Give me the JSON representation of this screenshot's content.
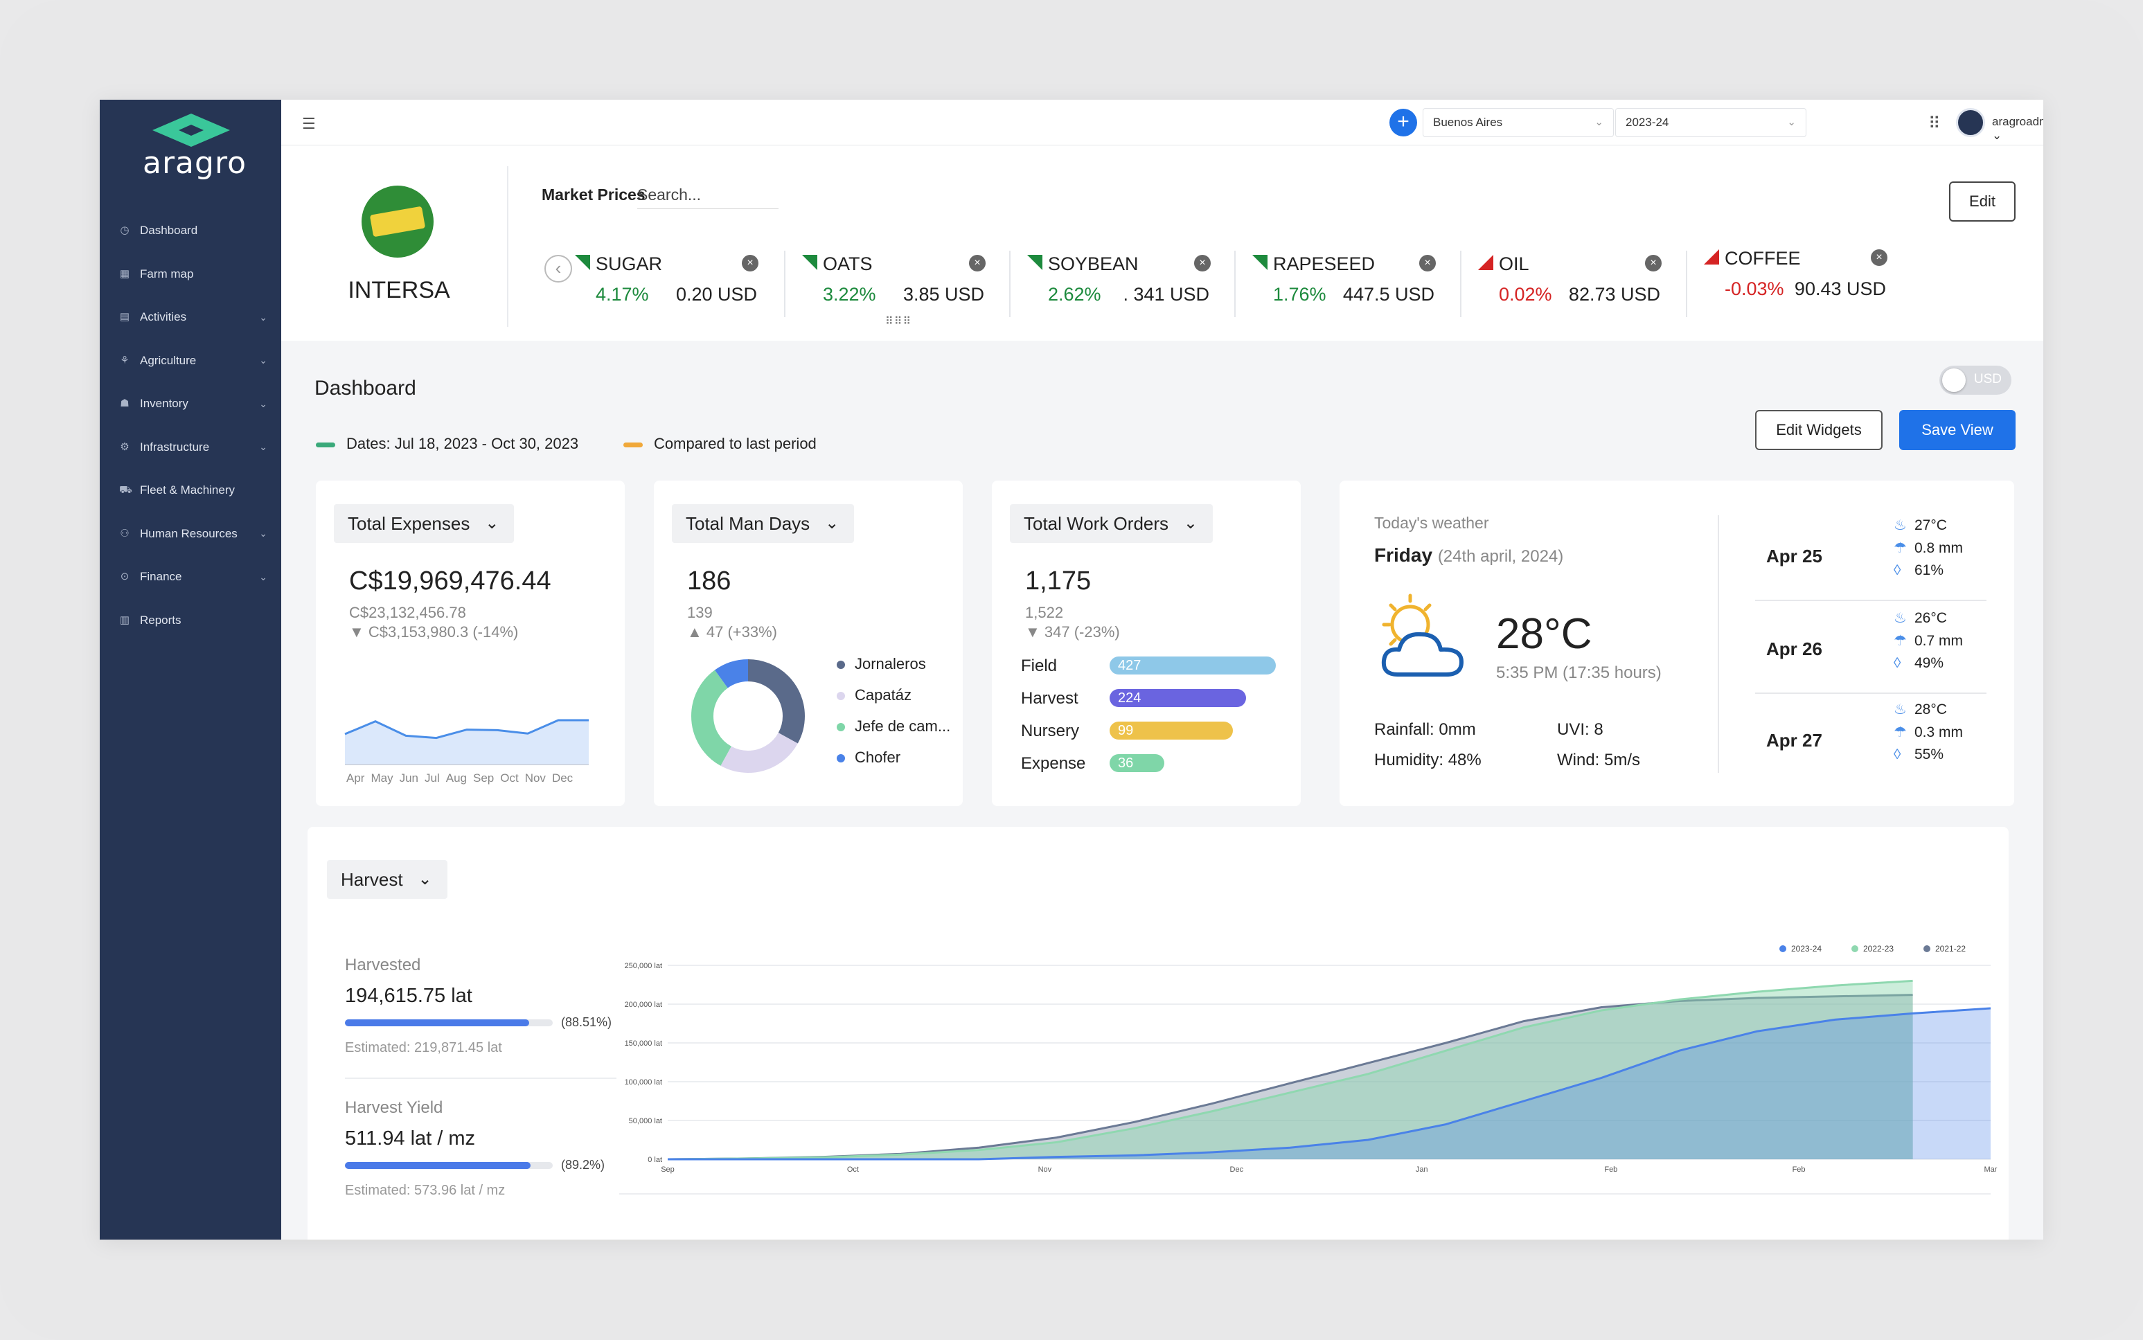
{
  "brand": {
    "name": "aragro"
  },
  "sidebar": {
    "items": [
      {
        "label": "Dashboard",
        "icon": "dashboard-icon",
        "has_children": false
      },
      {
        "label": "Farm map",
        "icon": "map-icon",
        "has_children": false
      },
      {
        "label": "Activities",
        "icon": "activities-icon",
        "has_children": true
      },
      {
        "label": "Agriculture",
        "icon": "plant-icon",
        "has_children": true
      },
      {
        "label": "Inventory",
        "icon": "inventory-icon",
        "has_children": true
      },
      {
        "label": "Infrastructure",
        "icon": "infrastructure-icon",
        "has_children": true
      },
      {
        "label": "Fleet & Machinery",
        "icon": "truck-icon",
        "has_children": false
      },
      {
        "label": "Human Resources",
        "icon": "people-icon",
        "has_children": true
      },
      {
        "label": "Finance",
        "icon": "finance-icon",
        "has_children": true
      },
      {
        "label": "Reports",
        "icon": "reports-icon",
        "has_children": false
      }
    ]
  },
  "topbar": {
    "location": "Buenos Aires",
    "season": "2023-24",
    "user": "aragroadmin"
  },
  "company": {
    "name": "INTERSA"
  },
  "market": {
    "title": "Market Prices",
    "search_placeholder": "Search...",
    "edit_label": "Edit",
    "tickers": [
      {
        "name": "SUGAR",
        "pct": "4.17%",
        "price": "0.20 USD",
        "trend": "up"
      },
      {
        "name": "OATS",
        "pct": "3.22%",
        "price": "3.85 USD",
        "trend": "up"
      },
      {
        "name": "SOYBEAN",
        "pct": "2.62%",
        "price": ". 341 USD",
        "trend": "up"
      },
      {
        "name": "RAPESEED",
        "pct": "1.76%",
        "price": "447.5 USD",
        "trend": "up"
      },
      {
        "name": "OIL",
        "pct": "0.02%",
        "price": "82.73 USD",
        "trend": "down"
      },
      {
        "name": "COFFEE",
        "pct": "-0.03%",
        "price": "90.43 USD",
        "trend": "down"
      }
    ]
  },
  "dashboard": {
    "title": "Dashboard",
    "dates_label": "Dates: Jul 18, 2023 - Oct 30, 2023",
    "compare_label": "Compared to last period",
    "currency_toggle": "USD",
    "edit_widgets": "Edit Widgets",
    "save_view": "Save View",
    "colors": {
      "dates": "#3aa97a",
      "compare": "#f0a83a",
      "primary": "#1f72e8",
      "sidebar": "#263554"
    }
  },
  "expenses": {
    "title": "Total Expenses",
    "value": "C$19,969,476.44",
    "previous": "C$23,132,456.78",
    "delta": "▼ C$3,153,980.3 (-14%)",
    "months": [
      "Apr",
      "May",
      "Jun",
      "Jul",
      "Aug",
      "Sep",
      "Oct",
      "Nov",
      "Dec"
    ],
    "trend": [
      0.55,
      0.78,
      0.52,
      0.48,
      0.63,
      0.62,
      0.56,
      0.8,
      0.8
    ]
  },
  "man_days": {
    "title": "Total Man Days",
    "value": "186",
    "previous": "139",
    "delta": "▲ 47 (+33%)",
    "legend": [
      {
        "label": "Jornaleros",
        "color": "#5a6a8a",
        "share": 0.33
      },
      {
        "label": "Capatáz",
        "color": "#dcd6ee",
        "share": 0.25
      },
      {
        "label": "Jefe de cam...",
        "color": "#7fd6a8",
        "share": 0.32
      },
      {
        "label": "Chofer",
        "color": "#4a82e8",
        "share": 0.1
      }
    ]
  },
  "work_orders": {
    "title": "Total Work Orders",
    "value": "1,175",
    "previous": "1,522",
    "delta": "▼ 347 (-23%)",
    "rows": [
      {
        "label": "Field",
        "value": "427",
        "color": "#8ec8e8",
        "fill": 1.0
      },
      {
        "label": "Harvest",
        "value": "224",
        "color": "#6a64e0",
        "fill": 0.82
      },
      {
        "label": "Nursery",
        "value": "99",
        "color": "#eec24a",
        "fill": 0.74
      },
      {
        "label": "Expense",
        "value": "36",
        "color": "#7fd6a8",
        "fill": 0.33
      }
    ]
  },
  "weather": {
    "label": "Today's weather",
    "day": "Friday",
    "date": "(24th april, 2024)",
    "temp": "28°C",
    "time": "5:35 PM (17:35 hours)",
    "rainfall": "Rainfall: 0mm",
    "uvi": "UVI: 8",
    "humidity": "Humidity: 48%",
    "wind": "Wind: 5m/s",
    "forecast": [
      {
        "date": "Apr 25",
        "temp": "27°C",
        "rain": "0.8 mm",
        "humidity": "61%"
      },
      {
        "date": "Apr 26",
        "temp": "26°C",
        "rain": "0.7 mm",
        "humidity": "49%"
      },
      {
        "date": "Apr 27",
        "temp": "28°C",
        "rain": "0.3 mm",
        "humidity": "55%"
      }
    ]
  },
  "harvest": {
    "selector": "Harvest",
    "harvested_label": "Harvested",
    "harvested_value": "194,615.75 lat",
    "harvested_pct": "(88.51%)",
    "harvested_fill": 0.8851,
    "harvested_est": "Estimated: 219,871.45 lat",
    "yield_label": "Harvest Yield",
    "yield_value": "511.94 lat / mz",
    "yield_pct": "(89.2%)",
    "yield_fill": 0.892,
    "yield_est": "Estimated: 573.96 lat / mz"
  },
  "chart_data": {
    "type": "area",
    "title": "",
    "xlabel": "",
    "ylabel": "",
    "x_ticks": [
      "Sep",
      "Oct",
      "Nov",
      "Dec",
      "Jan",
      "Feb",
      "Feb",
      "Mar"
    ],
    "y_ticks": [
      "250,000 lat",
      "200,000 lat",
      "150,000 lat",
      "100,000 lat",
      "50,000 lat",
      "0 lat"
    ],
    "ylim": [
      0,
      250000
    ],
    "legend_position": "top-right",
    "series": [
      {
        "name": "2023-24",
        "color": "#4a82e8",
        "values": [
          0,
          0,
          0,
          0,
          0,
          3000,
          5000,
          9000,
          15000,
          25000,
          45000,
          75000,
          105000,
          140000,
          165000,
          180000,
          188000,
          194600
        ]
      },
      {
        "name": "2022-23",
        "color": "#8fd8b0",
        "values": [
          0,
          1000,
          2500,
          6000,
          12000,
          22000,
          40000,
          62000,
          86000,
          110000,
          140000,
          170000,
          192000,
          206000,
          216000,
          224000,
          230000,
          null
        ]
      },
      {
        "name": "2021-22",
        "color": "#6b7a95",
        "values": [
          0,
          1000,
          3000,
          7000,
          15000,
          28000,
          48000,
          72000,
          98000,
          124000,
          150000,
          178000,
          196000,
          204000,
          208000,
          210000,
          212000,
          null
        ]
      }
    ]
  }
}
